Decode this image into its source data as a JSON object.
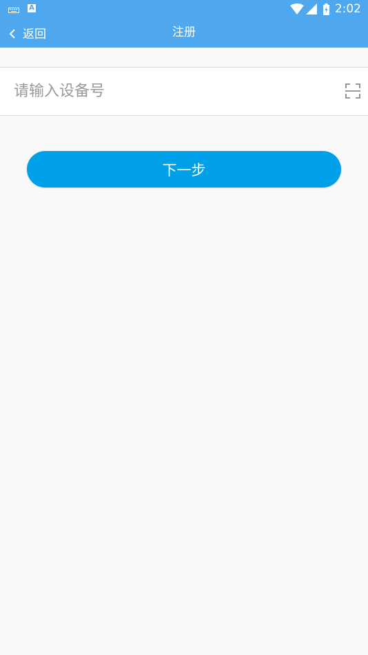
{
  "status_bar": {
    "time": "2:02",
    "left_icons": [
      "keyboard-icon",
      "a-icon"
    ],
    "a_icon_text": "A",
    "right_icons": [
      "wifi-icon",
      "signal-icon",
      "battery-icon"
    ]
  },
  "header": {
    "back_label": "返回",
    "title": "注册"
  },
  "form": {
    "device_placeholder": "请输入设备号",
    "device_value": "",
    "scan_icon": "scan-icon",
    "next_label": "下一步"
  },
  "colors": {
    "header_bg": "#4fa8ee",
    "button_bg": "#00a0e9",
    "page_bg": "#f9f9f9"
  }
}
